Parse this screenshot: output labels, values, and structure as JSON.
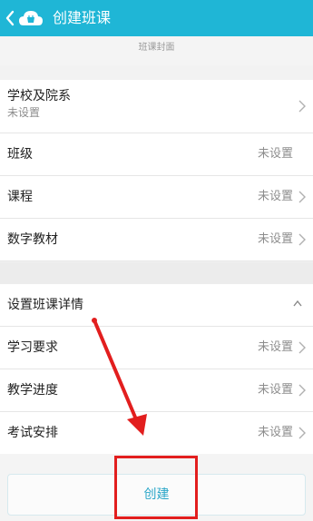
{
  "header": {
    "title": "创建班课",
    "back_icon": "back-chevron-icon",
    "logo_icon": "cloud-class-icon"
  },
  "cover_label": "班课封面",
  "section1": {
    "school_label": "学校及院系",
    "school_value": "未设置",
    "class_label": "班级",
    "class_value": "未设置",
    "course_label": "课程",
    "course_value": "未设置",
    "material_label": "数字教材",
    "material_value": "未设置"
  },
  "section2": {
    "details_label": "设置班课详情",
    "requirements_label": "学习要求",
    "requirements_value": "未设置",
    "progress_label": "教学进度",
    "progress_value": "未设置",
    "exam_label": "考试安排",
    "exam_value": "未设置"
  },
  "create_label": "创建",
  "colors": {
    "topbar": "#1fb6d6",
    "annotation": "#e21e1e"
  }
}
